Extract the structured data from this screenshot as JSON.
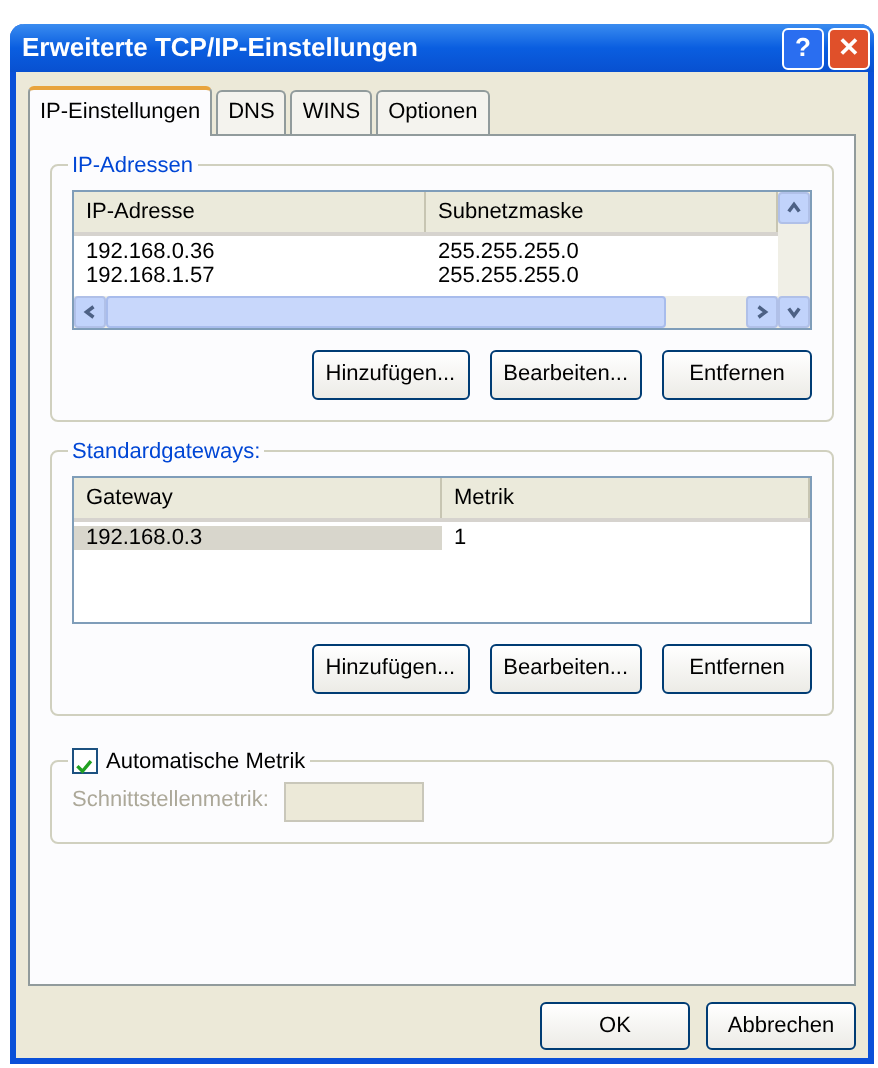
{
  "window": {
    "title": "Erweiterte TCP/IP-Einstellungen",
    "help": "?",
    "close": "✕"
  },
  "tabs": [
    {
      "label": "IP-Einstellungen",
      "selected": true
    },
    {
      "label": "DNS",
      "selected": false
    },
    {
      "label": "WINS",
      "selected": false
    },
    {
      "label": "Optionen",
      "selected": false
    }
  ],
  "groups": [
    {
      "legend": "IP-Adressen",
      "columns": [
        "IP-Adresse",
        "Subnetzmaske"
      ],
      "scrollbars": true,
      "rows": [
        {
          "cells": [
            "192.168.0.36",
            "255.255.255.0"
          ],
          "selected": false
        },
        {
          "cells": [
            "192.168.1.57",
            "255.255.255.0"
          ],
          "selected": false
        }
      ],
      "buttons": [
        "Hinzufügen...",
        "Bearbeiten...",
        "Entfernen"
      ]
    },
    {
      "legend": "Standardgateways:",
      "columns": [
        "Gateway",
        "Metrik"
      ],
      "scrollbars": false,
      "rows": [
        {
          "cells": [
            "192.168.0.3",
            "1"
          ],
          "selected": true
        }
      ],
      "buttons": [
        "Hinzufügen...",
        "Bearbeiten...",
        "Entfernen"
      ]
    }
  ],
  "metric": {
    "label": "Automatische Metrik",
    "checked": true,
    "field_label": "Schnittstellenmetrik:",
    "field_disabled": true
  },
  "buttons": [
    "OK",
    "Abbrechen"
  ]
}
